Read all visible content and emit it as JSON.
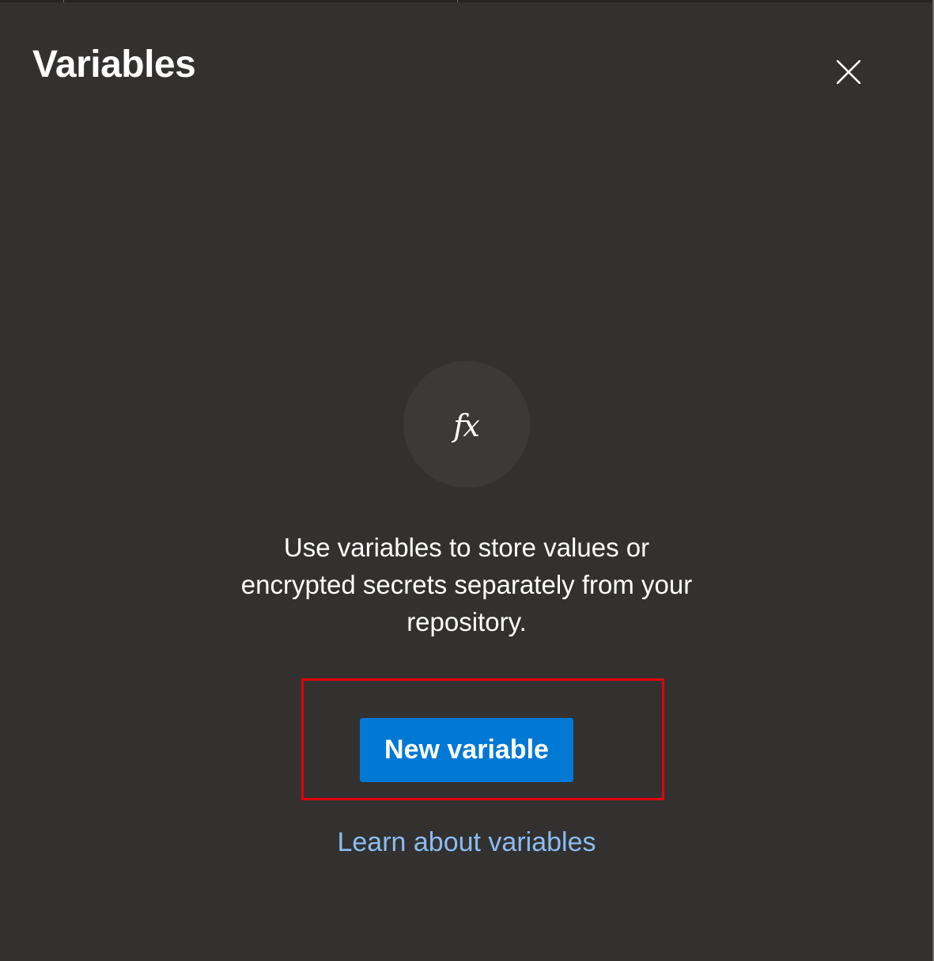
{
  "panel": {
    "title": "Variables",
    "close_icon": "close-icon"
  },
  "empty_state": {
    "icon": "function-fx-icon",
    "icon_glyph": "fx",
    "description": "Use variables to store values or encrypted secrets separately from your repository.",
    "new_button_label": "New variable",
    "learn_link_label": "Learn about variables"
  },
  "colors": {
    "background": "#323130",
    "primary_button": "#0078d4",
    "link": "#8cbcf0",
    "highlight": "#e3000b"
  }
}
